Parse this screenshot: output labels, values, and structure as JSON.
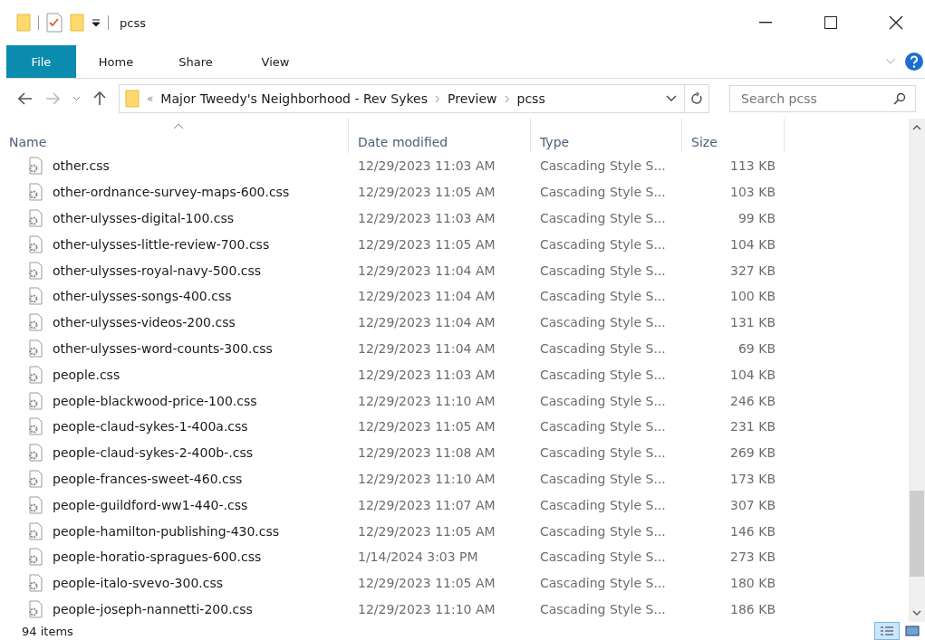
{
  "window": {
    "title": "pcss"
  },
  "ribbon": {
    "tabs": [
      {
        "label": "File",
        "selected": true
      },
      {
        "label": "Home",
        "selected": false
      },
      {
        "label": "Share",
        "selected": false
      },
      {
        "label": "View",
        "selected": false
      }
    ]
  },
  "address": {
    "prefix": "«",
    "crumbs": [
      "Major Tweedy's Neighborhood - Rev Sykes",
      "Preview",
      "pcss"
    ]
  },
  "search": {
    "placeholder": "Search pcss"
  },
  "table": {
    "columns": [
      {
        "label": "Name",
        "sorted": true
      },
      {
        "label": "Date modified",
        "sorted": false
      },
      {
        "label": "Type",
        "sorted": false
      },
      {
        "label": "Size",
        "sorted": false
      }
    ],
    "rows": [
      {
        "name": "other.css",
        "date": "12/29/2023 11:03 AM",
        "type": "Cascading Style S...",
        "size": "113 KB"
      },
      {
        "name": "other-ordnance-survey-maps-600.css",
        "date": "12/29/2023 11:05 AM",
        "type": "Cascading Style S...",
        "size": "103 KB"
      },
      {
        "name": "other-ulysses-digital-100.css",
        "date": "12/29/2023 11:03 AM",
        "type": "Cascading Style S...",
        "size": "99 KB"
      },
      {
        "name": "other-ulysses-little-review-700.css",
        "date": "12/29/2023 11:05 AM",
        "type": "Cascading Style S...",
        "size": "104 KB"
      },
      {
        "name": "other-ulysses-royal-navy-500.css",
        "date": "12/29/2023 11:04 AM",
        "type": "Cascading Style S...",
        "size": "327 KB"
      },
      {
        "name": "other-ulysses-songs-400.css",
        "date": "12/29/2023 11:04 AM",
        "type": "Cascading Style S...",
        "size": "100 KB"
      },
      {
        "name": "other-ulysses-videos-200.css",
        "date": "12/29/2023 11:04 AM",
        "type": "Cascading Style S...",
        "size": "131 KB"
      },
      {
        "name": "other-ulysses-word-counts-300.css",
        "date": "12/29/2023 11:04 AM",
        "type": "Cascading Style S...",
        "size": "69 KB"
      },
      {
        "name": "people.css",
        "date": "12/29/2023 11:03 AM",
        "type": "Cascading Style S...",
        "size": "104 KB"
      },
      {
        "name": "people-blackwood-price-100.css",
        "date": "12/29/2023 11:10 AM",
        "type": "Cascading Style S...",
        "size": "246 KB"
      },
      {
        "name": "people-claud-sykes-1-400a.css",
        "date": "12/29/2023 11:05 AM",
        "type": "Cascading Style S...",
        "size": "231 KB"
      },
      {
        "name": "people-claud-sykes-2-400b-.css",
        "date": "12/29/2023 11:08 AM",
        "type": "Cascading Style S...",
        "size": "269 KB"
      },
      {
        "name": "people-frances-sweet-460.css",
        "date": "12/29/2023 11:10 AM",
        "type": "Cascading Style S...",
        "size": "173 KB"
      },
      {
        "name": "people-guildford-ww1-440-.css",
        "date": "12/29/2023 11:07 AM",
        "type": "Cascading Style S...",
        "size": "307 KB"
      },
      {
        "name": "people-hamilton-publishing-430.css",
        "date": "12/29/2023 11:05 AM",
        "type": "Cascading Style S...",
        "size": "146 KB"
      },
      {
        "name": "people-horatio-spragues-600.css",
        "date": "1/14/2024 3:03 PM",
        "type": "Cascading Style S...",
        "size": "273 KB"
      },
      {
        "name": "people-italo-svevo-300.css",
        "date": "12/29/2023 11:05 AM",
        "type": "Cascading Style S...",
        "size": "180 KB"
      },
      {
        "name": "people-joseph-nannetti-200.css",
        "date": "12/29/2023 11:10 AM",
        "type": "Cascading Style S...",
        "size": "186 KB"
      }
    ]
  },
  "status_bar": {
    "count": "94 items"
  },
  "view_buttons": [
    {
      "kind": "details",
      "selected": true
    },
    {
      "kind": "tiles",
      "selected": false
    }
  ]
}
